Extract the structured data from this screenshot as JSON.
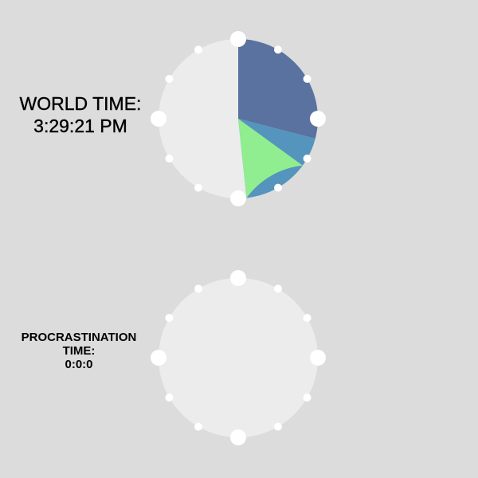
{
  "world_clock": {
    "title": "WORLD TIME:",
    "time": "3:29:21 PM",
    "hours": 3,
    "minutes": 29,
    "seconds": 21,
    "colors": {
      "face": "#ececec",
      "hour_wedge": "#5a72a0",
      "minute_wedge": "#5594bd",
      "second_wedge": "#90ee90",
      "markers": "#ffffff"
    }
  },
  "procrastination_clock": {
    "title_line1": "PROCRASTINATION",
    "title_line2": "TIME:",
    "time": "0:0:0",
    "hours": 0,
    "minutes": 0,
    "seconds": 0,
    "colors": {
      "face": "#ececec",
      "markers": "#ffffff"
    }
  }
}
